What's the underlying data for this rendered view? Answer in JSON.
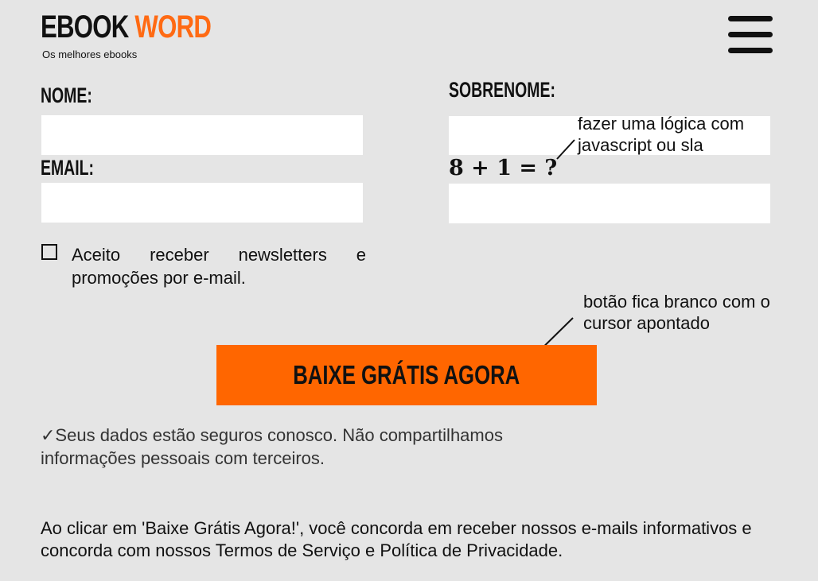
{
  "brand": {
    "name_part1": "EBOOK",
    "name_part2": "WORD",
    "tagline": "Os melhores ebooks",
    "accent_color": "#ff6a13"
  },
  "header": {
    "menu_icon": "hamburger-icon"
  },
  "form": {
    "nome_label": "NOME:",
    "sobrenome_label": "SOBRENOME:",
    "email_label": "EMAIL:",
    "captcha_question": "8 + 1 = ?",
    "newsletter_consent": "Aceito receber newsletters e promoções por e-mail.",
    "submit_label": "BAIXE GRÁTIS  AGORA",
    "submit_color": "#ff6600"
  },
  "annotations": {
    "captcha_note_line1": "fazer uma lógica com",
    "captcha_note_line2": "javascript ou sla",
    "button_note_line1": "botão fica branco com o",
    "button_note_line2": "cursor apontado"
  },
  "footer": {
    "privacy_note": "✓Seus dados estão seguros conosco. Não compartilhamos informações pessoais com terceiros.",
    "legal_notice": "Ao clicar em 'Baixe Grátis Agora!', você concorda em receber nossos e-mails informativos e concorda com nossos Termos de Serviço e Política de Privacidade."
  }
}
